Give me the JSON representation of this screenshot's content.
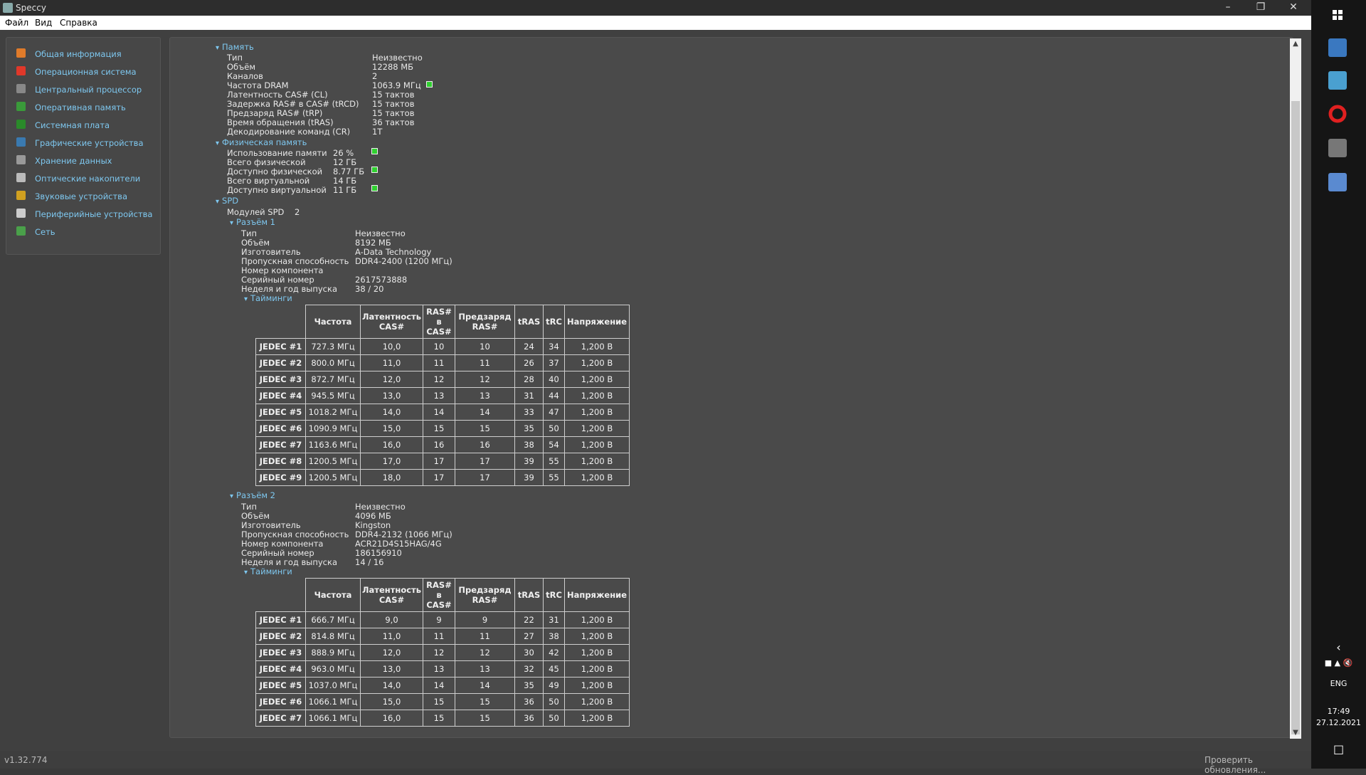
{
  "window": {
    "title": "Speccy"
  },
  "menu": [
    "Файл",
    "Вид",
    "Справка"
  ],
  "sidebar": [
    {
      "label": "Общая информация",
      "icon": "summary-icon",
      "color": "#e07b2a"
    },
    {
      "label": "Операционная система",
      "icon": "windows-icon",
      "color": "#e0382a"
    },
    {
      "label": "Центральный процессор",
      "icon": "cpu-icon",
      "color": "#888888"
    },
    {
      "label": "Оперативная память",
      "icon": "ram-icon",
      "color": "#3a9a3a"
    },
    {
      "label": "Системная плата",
      "icon": "motherboard-icon",
      "color": "#2a8a2a"
    },
    {
      "label": "Графические устройства",
      "icon": "monitor-icon",
      "color": "#3a7ab0"
    },
    {
      "label": "Хранение данных",
      "icon": "hdd-icon",
      "color": "#999999"
    },
    {
      "label": "Оптические накопители",
      "icon": "optical-disc-icon",
      "color": "#bbbbbb"
    },
    {
      "label": "Звуковые устройства",
      "icon": "speaker-icon",
      "color": "#d0a020"
    },
    {
      "label": "Периферийные устройства",
      "icon": "mouse-icon",
      "color": "#cccccc"
    },
    {
      "label": "Сеть",
      "icon": "network-icon",
      "color": "#4aa04a"
    }
  ],
  "memory": {
    "header": "Память",
    "rows": [
      {
        "label": "Тип",
        "value": "Неизвестно"
      },
      {
        "label": "Объём",
        "value": "12288 МБ"
      },
      {
        "label": "Каналов",
        "value": "2"
      },
      {
        "label": "Частота DRAM",
        "value": "1063.9 МГц"
      },
      {
        "label": "Латентность CAS# (CL)",
        "value": "15 тактов"
      },
      {
        "label": "Задержка RAS# в CAS# (tRCD)",
        "value": "15 тактов"
      },
      {
        "label": "Предзаряд RAS# (tRP)",
        "value": "15 тактов"
      },
      {
        "label": "Время обращения (tRAS)",
        "value": "36 тактов"
      },
      {
        "label": "Декодирование команд (CR)",
        "value": "1T"
      }
    ]
  },
  "physical": {
    "header": "Физическая память",
    "rows": [
      {
        "label": "Использование памяти",
        "value": "26 %"
      },
      {
        "label": "Всего физической",
        "value": "12 ГБ"
      },
      {
        "label": "Доступно физической",
        "value": "8.77 ГБ"
      },
      {
        "label": "Всего виртуальной",
        "value": "14 ГБ"
      },
      {
        "label": "Доступно виртуальной",
        "value": "11 ГБ"
      }
    ]
  },
  "spd": {
    "header": "SPD",
    "modules_label": "Модулей SPD",
    "modules_value": "2",
    "timings_label": "Тайминги",
    "columns": [
      "Частота",
      "Латентность CAS#",
      "RAS# в CAS#",
      "Предзаряд RAS#",
      "tRAS",
      "tRC",
      "Напряжение"
    ],
    "slots": [
      {
        "header": "Разъём 1",
        "rows": [
          {
            "label": "Тип",
            "value": "Неизвестно"
          },
          {
            "label": "Объём",
            "value": "8192 МБ"
          },
          {
            "label": "Изготовитель",
            "value": "A-Data Technology"
          },
          {
            "label": "Пропускная способность",
            "value": "DDR4-2400 (1200 МГц)"
          },
          {
            "label": "Номер компонента",
            "value": ""
          },
          {
            "label": "Серийный номер",
            "value": "2617573888"
          },
          {
            "label": "Неделя и год выпуска",
            "value": "38 / 20"
          }
        ],
        "timings": [
          [
            "JEDEC #1",
            "727.3 МГц",
            "10,0",
            "10",
            "10",
            "24",
            "34",
            "1,200 В"
          ],
          [
            "JEDEC #2",
            "800.0 МГц",
            "11,0",
            "11",
            "11",
            "26",
            "37",
            "1,200 В"
          ],
          [
            "JEDEC #3",
            "872.7 МГц",
            "12,0",
            "12",
            "12",
            "28",
            "40",
            "1,200 В"
          ],
          [
            "JEDEC #4",
            "945.5 МГц",
            "13,0",
            "13",
            "13",
            "31",
            "44",
            "1,200 В"
          ],
          [
            "JEDEC #5",
            "1018.2 МГц",
            "14,0",
            "14",
            "14",
            "33",
            "47",
            "1,200 В"
          ],
          [
            "JEDEC #6",
            "1090.9 МГц",
            "15,0",
            "15",
            "15",
            "35",
            "50",
            "1,200 В"
          ],
          [
            "JEDEC #7",
            "1163.6 МГц",
            "16,0",
            "16",
            "16",
            "38",
            "54",
            "1,200 В"
          ],
          [
            "JEDEC #8",
            "1200.5 МГц",
            "17,0",
            "17",
            "17",
            "39",
            "55",
            "1,200 В"
          ],
          [
            "JEDEC #9",
            "1200.5 МГц",
            "18,0",
            "17",
            "17",
            "39",
            "55",
            "1,200 В"
          ]
        ]
      },
      {
        "header": "Разъём 2",
        "rows": [
          {
            "label": "Тип",
            "value": "Неизвестно"
          },
          {
            "label": "Объём",
            "value": "4096 МБ"
          },
          {
            "label": "Изготовитель",
            "value": "Kingston"
          },
          {
            "label": "Пропускная способность",
            "value": "DDR4-2132 (1066 МГц)"
          },
          {
            "label": "Номер компонента",
            "value": "ACR21D4S15HAG/4G"
          },
          {
            "label": "Серийный номер",
            "value": "186156910"
          },
          {
            "label": "Неделя и год выпуска",
            "value": "14 / 16"
          }
        ],
        "timings": [
          [
            "JEDEC #1",
            "666.7 МГц",
            "9,0",
            "9",
            "9",
            "22",
            "31",
            "1,200 В"
          ],
          [
            "JEDEC #2",
            "814.8 МГц",
            "11,0",
            "11",
            "11",
            "27",
            "38",
            "1,200 В"
          ],
          [
            "JEDEC #3",
            "888.9 МГц",
            "12,0",
            "12",
            "12",
            "30",
            "42",
            "1,200 В"
          ],
          [
            "JEDEC #4",
            "963.0 МГц",
            "13,0",
            "13",
            "13",
            "32",
            "45",
            "1,200 В"
          ],
          [
            "JEDEC #5",
            "1037.0 МГц",
            "14,0",
            "14",
            "14",
            "35",
            "49",
            "1,200 В"
          ],
          [
            "JEDEC #6",
            "1066.1 МГц",
            "15,0",
            "15",
            "15",
            "36",
            "50",
            "1,200 В"
          ],
          [
            "JEDEC #7",
            "1066.1 МГц",
            "16,0",
            "15",
            "15",
            "36",
            "50",
            "1,200 В"
          ]
        ]
      }
    ]
  },
  "status": {
    "version": "v1.32.774",
    "update": "Проверить обновления..."
  },
  "taskbar": {
    "lang": "ENG",
    "time": "17:49",
    "date": "27.12.2021",
    "icons": [
      "windows-start-icon",
      "calculator-icon",
      "app-icon",
      "opera-icon",
      "speccy-icon",
      "remote-desktop-icon"
    ]
  }
}
